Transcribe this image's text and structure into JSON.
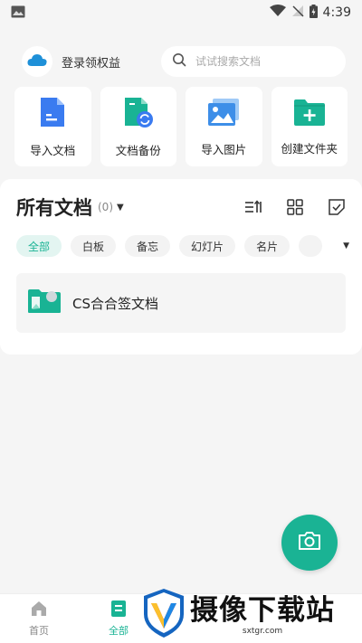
{
  "status_bar": {
    "time": "4:39"
  },
  "header": {
    "account_label": "登录领权益",
    "search_placeholder": "试试搜索文档"
  },
  "actions": [
    {
      "label": "导入文档",
      "icon": "import-document-icon"
    },
    {
      "label": "文档备份",
      "icon": "document-backup-icon"
    },
    {
      "label": "导入图片",
      "icon": "import-image-icon"
    },
    {
      "label": "创建文件夹",
      "icon": "create-folder-icon"
    }
  ],
  "documents": {
    "title": "所有文档",
    "count": "(0)",
    "filters": [
      "全部",
      "白板",
      "备忘",
      "幻灯片",
      "名片"
    ],
    "active_filter": "全部",
    "items": [
      {
        "name": "CS合合签文档",
        "icon": "folder-icon"
      }
    ]
  },
  "bottom_nav": [
    {
      "label": "首页",
      "icon": "home-icon"
    },
    {
      "label": "全部",
      "icon": "all-docs-icon"
    }
  ],
  "watermark": {
    "main": "摄像下载站",
    "sub": "sxtgr.com"
  },
  "colors": {
    "accent": "#1ab394",
    "active_chip_bg": "#e3f5f1",
    "background": "#f5f5f5"
  }
}
